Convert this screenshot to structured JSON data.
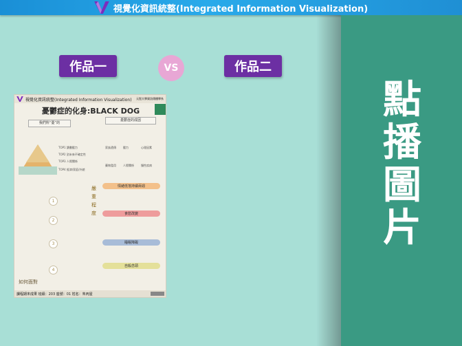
{
  "header": {
    "title": "視覺化資訊統整(Integrated Information Visualization)"
  },
  "labels": {
    "work1": "作品一",
    "vs": "VS",
    "work2": "作品二"
  },
  "right_panel": {
    "chars": [
      "點",
      "播",
      "圖",
      "片"
    ]
  },
  "poster": {
    "header_title": "視覺化資訊統整(Integrated Information Visualization)",
    "header_right": "元智大學資訊傳播學系",
    "main_title": "憂鬱症的化身:BLACK DOG",
    "section_we": "我們所“憂”的",
    "section_cause": "憂鬱症的成因",
    "top_items": [
      "TOP1  讀書壓力",
      "TOP2  對未來不確定性",
      "TOP3  人際關係",
      "TOP4  經濟/家庭/外貌"
    ],
    "cause_labels": [
      "家族遺傳",
      "壓力",
      "心理因素",
      "藥物濫用",
      "人際關係",
      "慢性疾病"
    ],
    "side_label": "嚴重程度",
    "pills": [
      "情緒低落持續兩週",
      "食慾改變",
      "睡眠障礙",
      "自殺念頭"
    ],
    "steps": [
      "1",
      "2",
      "3",
      "4"
    ],
    "how_face": "如何面對",
    "footer": "課程期末成果  班級：203  座號：01  姓名：朱丙屋"
  }
}
